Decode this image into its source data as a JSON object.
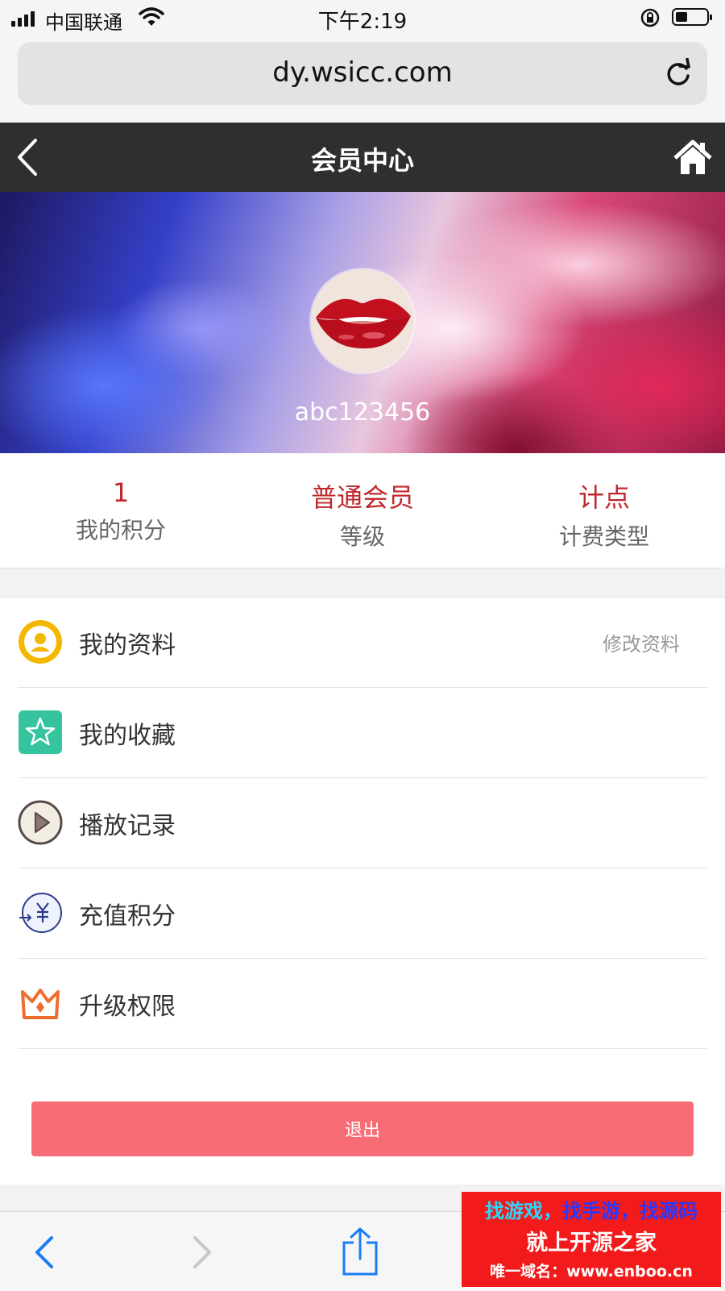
{
  "status_bar": {
    "carrier": "中国联通",
    "time": "下午2:19"
  },
  "browser": {
    "url": "dy.wsicc.com",
    "battery_level": 0.35
  },
  "header": {
    "title": "会员中心"
  },
  "profile": {
    "username": "abc123456"
  },
  "stats": [
    {
      "value": "1",
      "label": "我的积分"
    },
    {
      "value": "普通会员",
      "label": "等级"
    },
    {
      "value": "计点",
      "label": "计费类型"
    }
  ],
  "menu": [
    {
      "label": "我的资料",
      "extra": "修改资料",
      "icon": "user-icon",
      "color": "#f3b700"
    },
    {
      "label": "我的收藏",
      "icon": "star-icon",
      "color": "#36c49f"
    },
    {
      "label": "播放记录",
      "icon": "play-icon",
      "color": "#6b5454"
    },
    {
      "label": "充值积分",
      "icon": "yen-icon",
      "color": "#2d3b8c"
    },
    {
      "label": "升级权限",
      "icon": "crown-icon",
      "color": "#ee6e2e"
    }
  ],
  "logout_label": "退出",
  "watermark": {
    "line1a": "找游戏，",
    "line1b": "找手游，找源码",
    "line2": "就上开源之家",
    "line3": "唯一域名：www.enboo.cn"
  },
  "colors": {
    "accent_red": "#c0282d",
    "logout": "#f76c75",
    "header_bg": "#2f2f2f"
  }
}
